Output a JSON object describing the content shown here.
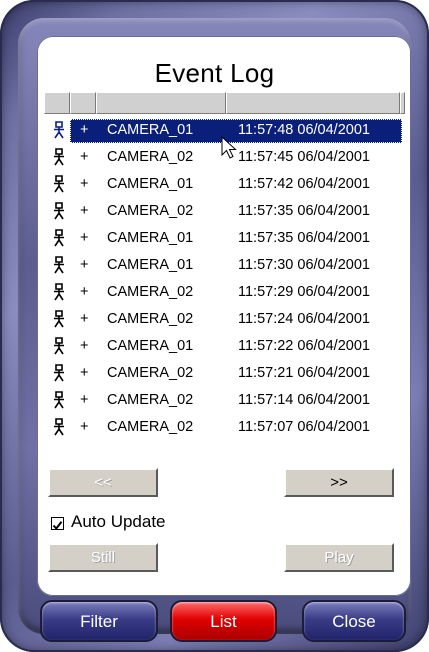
{
  "window": {
    "title": "Event Log"
  },
  "list": {
    "rows": [
      {
        "plus": "+",
        "camera": "CAMERA_01",
        "time": "11:57:48 06/04/2001",
        "selected": true
      },
      {
        "plus": "+",
        "camera": "CAMERA_02",
        "time": "11:57:45 06/04/2001"
      },
      {
        "plus": "+",
        "camera": "CAMERA_01",
        "time": "11:57:42 06/04/2001"
      },
      {
        "plus": "+",
        "camera": "CAMERA_02",
        "time": "11:57:35 06/04/2001"
      },
      {
        "plus": "+",
        "camera": "CAMERA_01",
        "time": "11:57:35 06/04/2001"
      },
      {
        "plus": "+",
        "camera": "CAMERA_01",
        "time": "11:57:30 06/04/2001"
      },
      {
        "plus": "+",
        "camera": "CAMERA_02",
        "time": "11:57:29 06/04/2001"
      },
      {
        "plus": "+",
        "camera": "CAMERA_02",
        "time": "11:57:24 06/04/2001"
      },
      {
        "plus": "+",
        "camera": "CAMERA_01",
        "time": "11:57:22 06/04/2001"
      },
      {
        "plus": "+",
        "camera": "CAMERA_02",
        "time": "11:57:21 06/04/2001"
      },
      {
        "plus": "+",
        "camera": "CAMERA_02",
        "time": "11:57:14 06/04/2001"
      },
      {
        "plus": "+",
        "camera": "CAMERA_02",
        "time": "11:57:07 06/04/2001"
      }
    ],
    "row_icon": "person-icon"
  },
  "nav": {
    "prev_label": "<<",
    "next_label": ">>"
  },
  "auto_update": {
    "label": "Auto Update",
    "checked": true
  },
  "actions": {
    "still_label": "Still",
    "play_label": "Play"
  },
  "bottom": {
    "filter_label": "Filter",
    "list_label": "List",
    "close_label": "Close"
  },
  "colors": {
    "selection": "#0a1f7a",
    "list_active": "#e00000",
    "frame": "#5b5d91"
  }
}
